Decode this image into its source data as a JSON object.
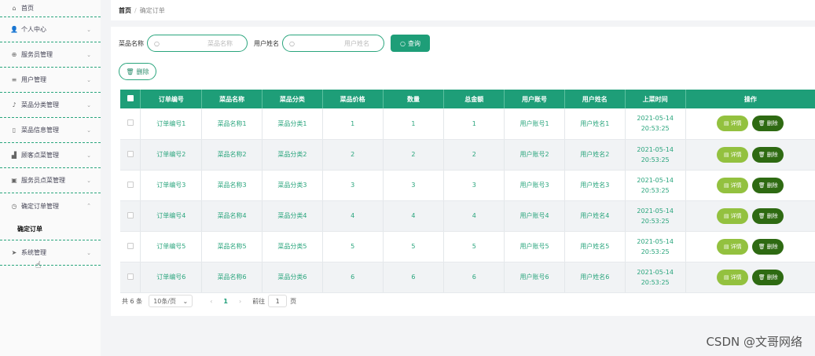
{
  "sidebar": {
    "items": [
      {
        "label": "首页",
        "icon": "home-icon",
        "glyph": "⌂",
        "chevron": ""
      },
      {
        "label": "个人中心",
        "icon": "user-icon",
        "glyph": "👤",
        "chevron": "⌄"
      },
      {
        "label": "服务员管理",
        "icon": "staff-icon",
        "glyph": "⊕",
        "chevron": "⌄"
      },
      {
        "label": "用户管理",
        "icon": "list-icon",
        "glyph": "≡",
        "chevron": "⌄"
      },
      {
        "label": "菜品分类管理",
        "icon": "mic-icon",
        "glyph": "♪",
        "chevron": "⌄"
      },
      {
        "label": "菜品信息管理",
        "icon": "phone-icon",
        "glyph": "▯",
        "chevron": "⌄"
      },
      {
        "label": "顾客点菜管理",
        "icon": "chart-icon",
        "glyph": "▟",
        "chevron": "⌄"
      },
      {
        "label": "服务员点菜管理",
        "icon": "briefcase-icon",
        "glyph": "▣",
        "chevron": "⌄"
      },
      {
        "label": "确定订单管理",
        "icon": "clock-icon",
        "glyph": "◷",
        "chevron": "⌃"
      }
    ],
    "submenu": "确定订单",
    "system": {
      "label": "系统管理",
      "glyph": "➤",
      "chevron": "⌄"
    }
  },
  "breadcrumb": {
    "home": "首页",
    "sep": "/",
    "current": "确定订单"
  },
  "search": {
    "dish_label": "菜品名称",
    "dish_placeholder": "菜品名称",
    "user_label": "用户姓名",
    "user_placeholder": "用户姓名",
    "query_label": "查询"
  },
  "delete_label": "删除",
  "table": {
    "headers": [
      "订单编号",
      "菜品名称",
      "菜品分类",
      "菜品价格",
      "数量",
      "总金额",
      "用户账号",
      "用户姓名",
      "上菜时间",
      "操作"
    ],
    "rows": [
      [
        "订单编号1",
        "菜品名称1",
        "菜品分类1",
        "1",
        "1",
        "1",
        "用户账号1",
        "用户姓名1",
        "2021-05-14 20:53:25"
      ],
      [
        "订单编号2",
        "菜品名称2",
        "菜品分类2",
        "2",
        "2",
        "2",
        "用户账号2",
        "用户姓名2",
        "2021-05-14 20:53:25"
      ],
      [
        "订单编号3",
        "菜品名称3",
        "菜品分类3",
        "3",
        "3",
        "3",
        "用户账号3",
        "用户姓名3",
        "2021-05-14 20:53:25"
      ],
      [
        "订单编号4",
        "菜品名称4",
        "菜品分类4",
        "4",
        "4",
        "4",
        "用户账号4",
        "用户姓名4",
        "2021-05-14 20:53:25"
      ],
      [
        "订单编号5",
        "菜品名称5",
        "菜品分类5",
        "5",
        "5",
        "5",
        "用户账号5",
        "用户姓名5",
        "2021-05-14 20:53:25"
      ],
      [
        "订单编号6",
        "菜品名称6",
        "菜品分类6",
        "6",
        "6",
        "6",
        "用户账号6",
        "用户姓名6",
        "2021-05-14 20:53:25"
      ]
    ],
    "detail_label": "详情",
    "delete_label": "删除"
  },
  "pagination": {
    "total": "共 6 条",
    "page_size": "10条/页",
    "current_page": "1",
    "goto_label": "前往",
    "goto_value": "1",
    "page_suffix": "页"
  },
  "watermark": "CSDN @文哥网络",
  "colors": {
    "primary": "#1e9e78",
    "detail": "#93c13f",
    "delete": "#2e6a12"
  }
}
